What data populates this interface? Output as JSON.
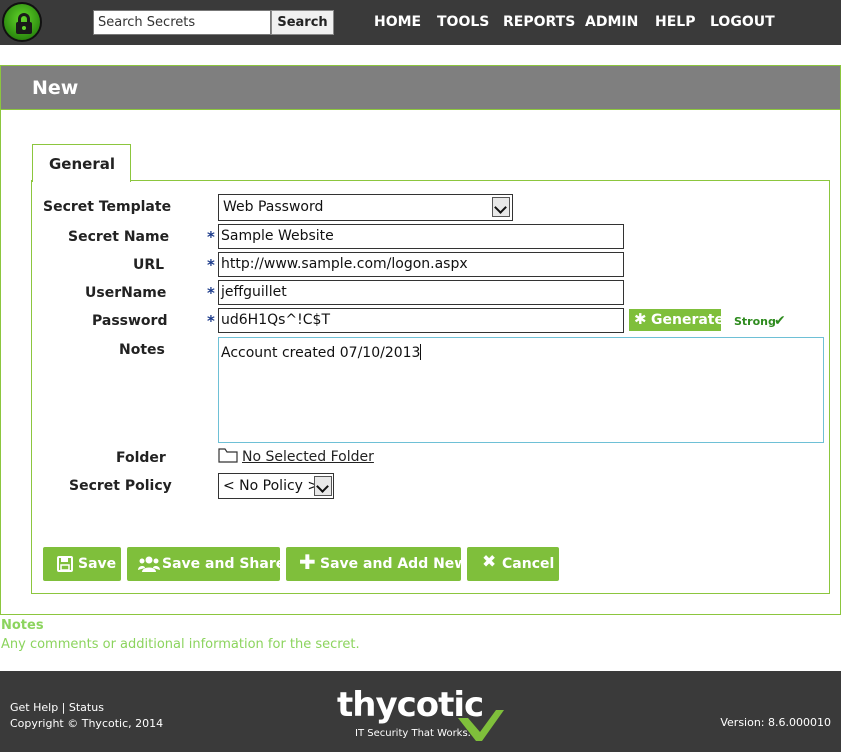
{
  "topbar": {
    "search_placeholder": "Search Secrets",
    "search_button": "Search",
    "nav": [
      "HOME",
      "TOOLS",
      "REPORTS",
      "ADMIN",
      "HELP",
      "LOGOUT"
    ]
  },
  "page": {
    "title": "New"
  },
  "tabs": [
    {
      "label": "General",
      "active": true
    }
  ],
  "form": {
    "template_label": "Secret Template",
    "template_value": "Web Password",
    "name_label": "Secret Name",
    "name_value": "Sample Website",
    "url_label": "URL",
    "url_value": "http://www.sample.com/logon.aspx",
    "username_label": "UserName",
    "username_value": "jeffguillet",
    "password_label": "Password",
    "password_value": "ud6H1Qs^!C$T",
    "required_marker": "*",
    "generate_button": "Generate",
    "strength": "Strong",
    "notes_label": "Notes",
    "notes_value": "Account created 07/10/2013",
    "folder_label": "Folder",
    "folder_value": "No Selected Folder",
    "policy_label": "Secret Policy",
    "policy_value": "< No Policy >"
  },
  "actions": {
    "save": "Save",
    "save_share": "Save and Share",
    "save_add_new": "Save and Add New",
    "cancel": "Cancel"
  },
  "help": {
    "title": "Notes",
    "text": "Any comments or additional information for the secret."
  },
  "footer": {
    "links": "Get Help | Status",
    "copyright": "Copyright © Thycotic, 2014",
    "brand": "thycotic",
    "tagline": "IT Security That Works.",
    "version": "Version: 8.6.000010"
  },
  "colors": {
    "accent_green": "#7fbf3b",
    "bar_dark": "#3a3a3a",
    "header_gray": "#7f7f7f",
    "help_green": "#8cd45e",
    "required_blue": "#1b3a8a"
  }
}
